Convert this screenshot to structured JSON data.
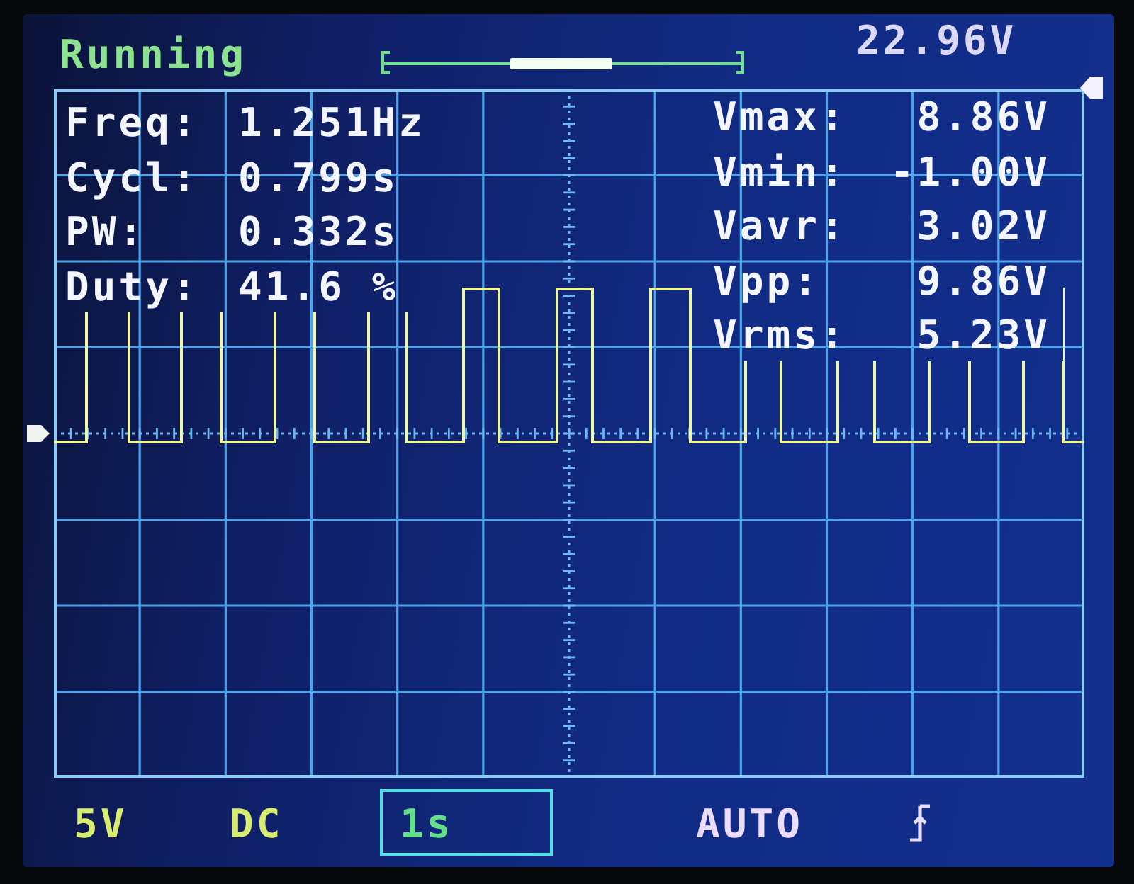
{
  "status_bar": {
    "state": "Running",
    "voltage_reading": "22.96V"
  },
  "measurements_left": [
    {
      "label": "Freq:",
      "value": "1.251Hz"
    },
    {
      "label": "Cycl:",
      "value": "0.799s"
    },
    {
      "label": "PW:",
      "value": "0.332s"
    },
    {
      "label": "Duty:",
      "value": "41.6 %"
    }
  ],
  "measurements_right": [
    {
      "label": "Vmax:",
      "value": "8.86V"
    },
    {
      "label": "Vmin:",
      "value": "-1.00V"
    },
    {
      "label": "Vavr:",
      "value": "3.02V"
    },
    {
      "label": "Vpp:",
      "value": "9.86V"
    },
    {
      "label": "Vrms:",
      "value": "5.23V"
    }
  ],
  "settings": [
    {
      "text": "5V",
      "color": "#d8ec70",
      "selected": false
    },
    {
      "text": "DC",
      "color": "#d8ec70",
      "selected": false
    },
    {
      "text": "1s",
      "color": "#62e08e",
      "selected": true
    },
    {
      "text": "AUTO",
      "color": "#ecdcff",
      "selected": false
    }
  ]
}
